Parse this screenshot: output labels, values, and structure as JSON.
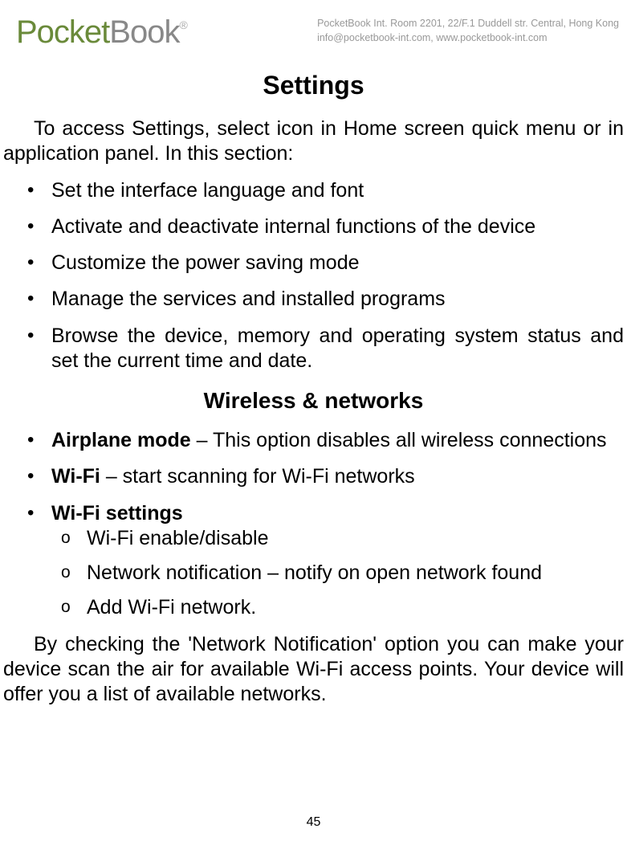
{
  "header": {
    "logo_pocket": "Pocket",
    "logo_book": "Book",
    "logo_reg": "®",
    "address_line1": "PocketBook Int. Room 2201, 22/F.1 Duddell str. Central, Hong Kong",
    "address_line2": "info@pocketbook-int.com, www.pocketbook-int.com"
  },
  "title": "Settings",
  "intro": "To access Settings, select icon in Home screen quick menu or in application panel. In this section:",
  "bullets": [
    "Set the interface language and font",
    "Activate and deactivate internal functions of the device",
    "Customize the power saving mode",
    "Manage the services and installed programs",
    "Browse the device, memory and operating system status and set the current time and date."
  ],
  "subtitle": "Wireless & networks",
  "wireless": [
    {
      "bold": "Airplane mode",
      "rest": " – This option disables all wireless connections"
    },
    {
      "bold": "Wi-Fi",
      "rest": " – start scanning for Wi-Fi networks"
    },
    {
      "bold": "Wi-Fi settings",
      "rest": ""
    }
  ],
  "wifi_sub": [
    "Wi-Fi enable/disable",
    "Network notification – notify on open network found",
    "Add Wi-Fi network."
  ],
  "closing": "By checking the 'Network Notification' option you can make your device scan the air for available Wi-Fi access points. Your device will offer you a list of available networks.",
  "page_number": "45"
}
